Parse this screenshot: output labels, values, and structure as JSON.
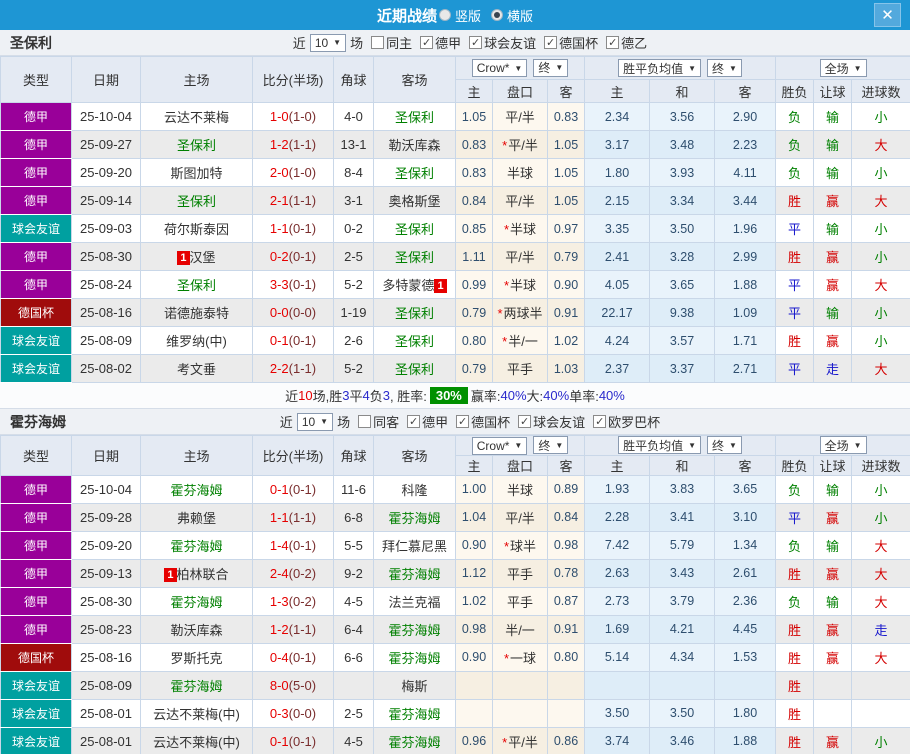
{
  "titlebar": {
    "title": "近期战绩",
    "radios": [
      {
        "label": "竖版",
        "selected": false
      },
      {
        "label": "横版",
        "selected": true
      }
    ]
  },
  "icons": {
    "close": "✕",
    "check": "✓",
    "dropdown": "▼",
    "badge": "1"
  },
  "filter_words": {
    "near": "近",
    "count": "10",
    "games": "场"
  },
  "columns": {
    "type": "类型",
    "date": "日期",
    "home": "主场",
    "score": "比分(半场)",
    "corner": "角球",
    "away": "客场",
    "odds_sub": [
      "主",
      "盘口",
      "客"
    ],
    "avg_sub": [
      "主",
      "和",
      "客"
    ],
    "result_sub": [
      "胜负",
      "让球",
      "进球数"
    ],
    "selects": {
      "company": "Crow*",
      "final1": "终",
      "avg": "胜平负均值",
      "final2": "终",
      "fulltime": "全场"
    }
  },
  "league_colors": {
    "德甲": "#990099",
    "球会友谊": "#00a0a0",
    "德国杯": "#a00c0c"
  },
  "result_colors": {
    "胜": "red",
    "赢": "red",
    "大": "red",
    "平": "blue",
    "走": "blue",
    "负": "green",
    "输": "green",
    "小": "green"
  },
  "sections": [
    {
      "team": "圣保利",
      "same_label": "同主",
      "leagues": [
        "德甲",
        "球会友谊",
        "德国杯",
        "德乙"
      ],
      "rows": [
        {
          "league": "德甲",
          "date": "25-10-04",
          "home": "云达不莱梅",
          "home_focus": false,
          "home_badge": "",
          "ft": "1-0",
          "ht": "(1-0)",
          "corner": "4-0",
          "away": "圣保利",
          "away_focus": true,
          "away_badge": "",
          "odds": [
            "1.05",
            "平/半",
            "0.83"
          ],
          "avg": [
            "2.34",
            "3.56",
            "2.90"
          ],
          "results": [
            "负",
            "输",
            "小"
          ]
        },
        {
          "league": "德甲",
          "date": "25-09-27",
          "home": "圣保利",
          "home_focus": true,
          "home_badge": "",
          "ft": "1-2",
          "ht": "(1-1)",
          "corner": "13-1",
          "away": "勒沃库森",
          "away_focus": false,
          "away_badge": "",
          "odds": [
            "0.83",
            "*平/半",
            "1.05"
          ],
          "avg": [
            "3.17",
            "3.48",
            "2.23"
          ],
          "results": [
            "负",
            "输",
            "大"
          ]
        },
        {
          "league": "德甲",
          "date": "25-09-20",
          "home": "斯图加特",
          "home_focus": false,
          "home_badge": "",
          "ft": "2-0",
          "ht": "(1-0)",
          "corner": "8-4",
          "away": "圣保利",
          "away_focus": true,
          "away_badge": "",
          "odds": [
            "0.83",
            "半球",
            "1.05"
          ],
          "avg": [
            "1.80",
            "3.93",
            "4.11"
          ],
          "results": [
            "负",
            "输",
            "小"
          ]
        },
        {
          "league": "德甲",
          "date": "25-09-14",
          "home": "圣保利",
          "home_focus": true,
          "home_badge": "",
          "ft": "2-1",
          "ht": "(1-1)",
          "corner": "3-1",
          "away": "奥格斯堡",
          "away_focus": false,
          "away_badge": "",
          "odds": [
            "0.84",
            "平/半",
            "1.05"
          ],
          "avg": [
            "2.15",
            "3.34",
            "3.44"
          ],
          "results": [
            "胜",
            "赢",
            "大"
          ]
        },
        {
          "league": "球会友谊",
          "date": "25-09-03",
          "home": "荷尔斯泰因",
          "home_focus": false,
          "home_badge": "",
          "ft": "1-1",
          "ht": "(0-1)",
          "corner": "0-2",
          "away": "圣保利",
          "away_focus": true,
          "away_badge": "",
          "odds": [
            "0.85",
            "*半球",
            "0.97"
          ],
          "avg": [
            "3.35",
            "3.50",
            "1.96"
          ],
          "results": [
            "平",
            "输",
            "小"
          ]
        },
        {
          "league": "德甲",
          "date": "25-08-30",
          "home": "汉堡",
          "home_focus": false,
          "home_badge": "pre",
          "ft": "0-2",
          "ht": "(0-1)",
          "corner": "2-5",
          "away": "圣保利",
          "away_focus": true,
          "away_badge": "",
          "odds": [
            "1.11",
            "平/半",
            "0.79"
          ],
          "avg": [
            "2.41",
            "3.28",
            "2.99"
          ],
          "results": [
            "胜",
            "赢",
            "小"
          ]
        },
        {
          "league": "德甲",
          "date": "25-08-24",
          "home": "圣保利",
          "home_focus": true,
          "home_badge": "",
          "ft": "3-3",
          "ht": "(0-1)",
          "corner": "5-2",
          "away": "多特蒙德",
          "away_focus": false,
          "away_badge": "post",
          "odds": [
            "0.99",
            "*半球",
            "0.90"
          ],
          "avg": [
            "4.05",
            "3.65",
            "1.88"
          ],
          "results": [
            "平",
            "赢",
            "大"
          ]
        },
        {
          "league": "德国杯",
          "date": "25-08-16",
          "home": "诺德施泰特",
          "home_focus": false,
          "home_badge": "",
          "ft": "0-0",
          "ht": "(0-0)",
          "corner": "1-19",
          "away": "圣保利",
          "away_focus": true,
          "away_badge": "",
          "odds": [
            "0.79",
            "*两球半",
            "0.91"
          ],
          "avg": [
            "22.17",
            "9.38",
            "1.09"
          ],
          "results": [
            "平",
            "输",
            "小"
          ]
        },
        {
          "league": "球会友谊",
          "date": "25-08-09",
          "home": "维罗纳(中)",
          "home_focus": false,
          "home_badge": "",
          "ft": "0-1",
          "ht": "(0-1)",
          "corner": "2-6",
          "away": "圣保利",
          "away_focus": true,
          "away_badge": "",
          "odds": [
            "0.80",
            "*半/一",
            "1.02"
          ],
          "avg": [
            "4.24",
            "3.57",
            "1.71"
          ],
          "results": [
            "胜",
            "赢",
            "小"
          ]
        },
        {
          "league": "球会友谊",
          "date": "25-08-02",
          "home": "考文垂",
          "home_focus": false,
          "home_badge": "",
          "ft": "2-2",
          "ht": "(1-1)",
          "corner": "5-2",
          "away": "圣保利",
          "away_focus": true,
          "away_badge": "",
          "odds": [
            "0.79",
            "平手",
            "1.03"
          ],
          "avg": [
            "2.37",
            "3.37",
            "2.71"
          ],
          "results": [
            "平",
            "走",
            "大"
          ]
        }
      ],
      "summary": [
        {
          "t": "近"
        },
        {
          "t": "10",
          "c": "red"
        },
        {
          "t": "场,胜"
        },
        {
          "t": "3",
          "c": "blue"
        },
        {
          "t": "平"
        },
        {
          "t": "4",
          "c": "blue"
        },
        {
          "t": "负"
        },
        {
          "t": "3",
          "c": "blue"
        },
        {
          "t": ", 胜率: "
        },
        {
          "t": "30%",
          "badge": true
        },
        {
          "t": " 赢率:"
        },
        {
          "t": "40%",
          "c": "blue"
        },
        {
          "t": " 大:"
        },
        {
          "t": "40%",
          "c": "blue"
        },
        {
          "t": " 单率:"
        },
        {
          "t": "40%",
          "c": "blue"
        }
      ]
    },
    {
      "team": "霍芬海姆",
      "same_label": "同客",
      "leagues": [
        "德甲",
        "德国杯",
        "球会友谊",
        "欧罗巴杯"
      ],
      "rows": [
        {
          "league": "德甲",
          "date": "25-10-04",
          "home": "霍芬海姆",
          "home_focus": true,
          "home_badge": "",
          "ft": "0-1",
          "ht": "(0-1)",
          "corner": "11-6",
          "away": "科隆",
          "away_focus": false,
          "away_badge": "",
          "odds": [
            "1.00",
            "半球",
            "0.89"
          ],
          "avg": [
            "1.93",
            "3.83",
            "3.65"
          ],
          "results": [
            "负",
            "输",
            "小"
          ]
        },
        {
          "league": "德甲",
          "date": "25-09-28",
          "home": "弗赖堡",
          "home_focus": false,
          "home_badge": "",
          "ft": "1-1",
          "ht": "(1-1)",
          "corner": "6-8",
          "away": "霍芬海姆",
          "away_focus": true,
          "away_badge": "",
          "odds": [
            "1.04",
            "平/半",
            "0.84"
          ],
          "avg": [
            "2.28",
            "3.41",
            "3.10"
          ],
          "results": [
            "平",
            "赢",
            "小"
          ]
        },
        {
          "league": "德甲",
          "date": "25-09-20",
          "home": "霍芬海姆",
          "home_focus": true,
          "home_badge": "",
          "ft": "1-4",
          "ht": "(0-1)",
          "corner": "5-5",
          "away": "拜仁慕尼黑",
          "away_focus": false,
          "away_badge": "",
          "odds": [
            "0.90",
            "*球半",
            "0.98"
          ],
          "avg": [
            "7.42",
            "5.79",
            "1.34"
          ],
          "results": [
            "负",
            "输",
            "大"
          ]
        },
        {
          "league": "德甲",
          "date": "25-09-13",
          "home": "柏林联合",
          "home_focus": false,
          "home_badge": "pre",
          "ft": "2-4",
          "ht": "(0-2)",
          "corner": "9-2",
          "away": "霍芬海姆",
          "away_focus": true,
          "away_badge": "",
          "odds": [
            "1.12",
            "平手",
            "0.78"
          ],
          "avg": [
            "2.63",
            "3.43",
            "2.61"
          ],
          "results": [
            "胜",
            "赢",
            "大"
          ]
        },
        {
          "league": "德甲",
          "date": "25-08-30",
          "home": "霍芬海姆",
          "home_focus": true,
          "home_badge": "",
          "ft": "1-3",
          "ht": "(0-2)",
          "corner": "4-5",
          "away": "法兰克福",
          "away_focus": false,
          "away_badge": "",
          "odds": [
            "1.02",
            "平手",
            "0.87"
          ],
          "avg": [
            "2.73",
            "3.79",
            "2.36"
          ],
          "results": [
            "负",
            "输",
            "大"
          ]
        },
        {
          "league": "德甲",
          "date": "25-08-23",
          "home": "勒沃库森",
          "home_focus": false,
          "home_badge": "",
          "ft": "1-2",
          "ht": "(1-1)",
          "corner": "6-4",
          "away": "霍芬海姆",
          "away_focus": true,
          "away_badge": "",
          "odds": [
            "0.98",
            "半/一",
            "0.91"
          ],
          "avg": [
            "1.69",
            "4.21",
            "4.45"
          ],
          "results": [
            "胜",
            "赢",
            "走"
          ]
        },
        {
          "league": "德国杯",
          "date": "25-08-16",
          "home": "罗斯托克",
          "home_focus": false,
          "home_badge": "",
          "ft": "0-4",
          "ht": "(0-1)",
          "corner": "6-6",
          "away": "霍芬海姆",
          "away_focus": true,
          "away_badge": "",
          "odds": [
            "0.90",
            "*一球",
            "0.80"
          ],
          "avg": [
            "5.14",
            "4.34",
            "1.53"
          ],
          "results": [
            "胜",
            "赢",
            "大"
          ]
        },
        {
          "league": "球会友谊",
          "date": "25-08-09",
          "home": "霍芬海姆",
          "home_focus": true,
          "home_badge": "",
          "ft": "8-0",
          "ht": "(5-0)",
          "corner": "",
          "away": "梅斯",
          "away_focus": false,
          "away_badge": "",
          "odds": [
            "",
            "",
            ""
          ],
          "avg": [
            "",
            "",
            ""
          ],
          "results": [
            "胜",
            "",
            ""
          ]
        },
        {
          "league": "球会友谊",
          "date": "25-08-01",
          "home": "云达不莱梅(中)",
          "home_focus": false,
          "home_badge": "",
          "ft": "0-3",
          "ht": "(0-0)",
          "corner": "2-5",
          "away": "霍芬海姆",
          "away_focus": true,
          "away_badge": "",
          "odds": [
            "",
            "",
            ""
          ],
          "avg": [
            "3.50",
            "3.50",
            "1.80"
          ],
          "results": [
            "胜",
            "",
            ""
          ]
        },
        {
          "league": "球会友谊",
          "date": "25-08-01",
          "home": "云达不莱梅(中)",
          "home_focus": false,
          "home_badge": "",
          "ft": "0-1",
          "ht": "(0-1)",
          "corner": "4-5",
          "away": "霍芬海姆",
          "away_focus": true,
          "away_badge": "",
          "odds": [
            "0.96",
            "*平/半",
            "0.86"
          ],
          "avg": [
            "3.74",
            "3.46",
            "1.88"
          ],
          "results": [
            "胜",
            "赢",
            "小"
          ]
        }
      ],
      "summary": null
    }
  ]
}
